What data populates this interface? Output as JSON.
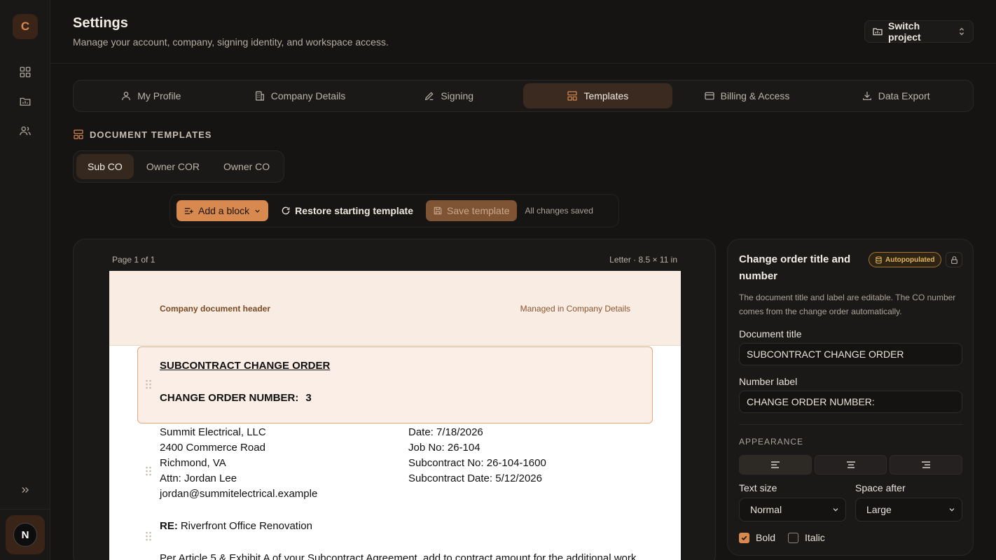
{
  "app": {
    "logo_letter": "C",
    "user_initial": "N"
  },
  "header": {
    "title": "Settings",
    "subtitle": "Manage your account, company, signing identity, and workspace access.",
    "switch_project": "Switch project"
  },
  "tabs": [
    {
      "label": "My Profile",
      "icon": "user-icon"
    },
    {
      "label": "Company Details",
      "icon": "building-icon"
    },
    {
      "label": "Signing",
      "icon": "pen-icon"
    },
    {
      "label": "Templates",
      "icon": "layout-icon",
      "active": true
    },
    {
      "label": "Billing & Access",
      "icon": "credit-card-icon"
    },
    {
      "label": "Data Export",
      "icon": "download-icon"
    }
  ],
  "section": {
    "title": "DOCUMENT TEMPLATES"
  },
  "subtabs": [
    {
      "label": "Sub CO",
      "active": true
    },
    {
      "label": "Owner COR"
    },
    {
      "label": "Owner CO"
    }
  ],
  "toolbar": {
    "add_block": "Add a block",
    "restore": "Restore starting template",
    "save": "Save template",
    "status": "All changes saved"
  },
  "canvas": {
    "page_label": "Page 1 of 1",
    "page_size": "Letter · 8.5 × 11 in",
    "header_left": "Company document header",
    "header_right": "Managed in Company Details",
    "doc_title": "SUBCONTRACT CHANGE ORDER",
    "number_label": "CHANGE ORDER NUMBER:",
    "number_value": "3",
    "party_left": [
      "Summit Electrical, LLC",
      "2400 Commerce Road",
      "Richmond, VA",
      "Attn: Jordan Lee",
      "jordan@summitelectrical.example"
    ],
    "party_right": [
      "Date: 7/18/2026",
      "Job No: 26-104",
      "Subcontract No: 26-104-1600",
      "Subcontract Date: 5/12/2026"
    ],
    "re_label": "RE:",
    "re_value": "Riverfront Office Renovation",
    "body_line": "Per Article 5 & Exhibit A of your Subcontract Agreement, add to contract amount for the additional work"
  },
  "inspector": {
    "title": "Change order title and number",
    "badge": "Autopopulated",
    "description": "The document title and label are editable. The CO number comes from the change order automatically.",
    "doc_title_label": "Document title",
    "doc_title_value": "SUBCONTRACT CHANGE ORDER",
    "number_label_label": "Number label",
    "number_label_value": "CHANGE ORDER NUMBER:",
    "appearance": "APPEARANCE",
    "text_size_label": "Text size",
    "text_size_value": "Normal",
    "space_after_label": "Space after",
    "space_after_value": "Large",
    "bold_label": "Bold",
    "bold": true,
    "italic_label": "Italic",
    "italic": false
  },
  "colors": {
    "accent": "#d8894f",
    "background": "#161412",
    "badge": "#e3b45d"
  }
}
